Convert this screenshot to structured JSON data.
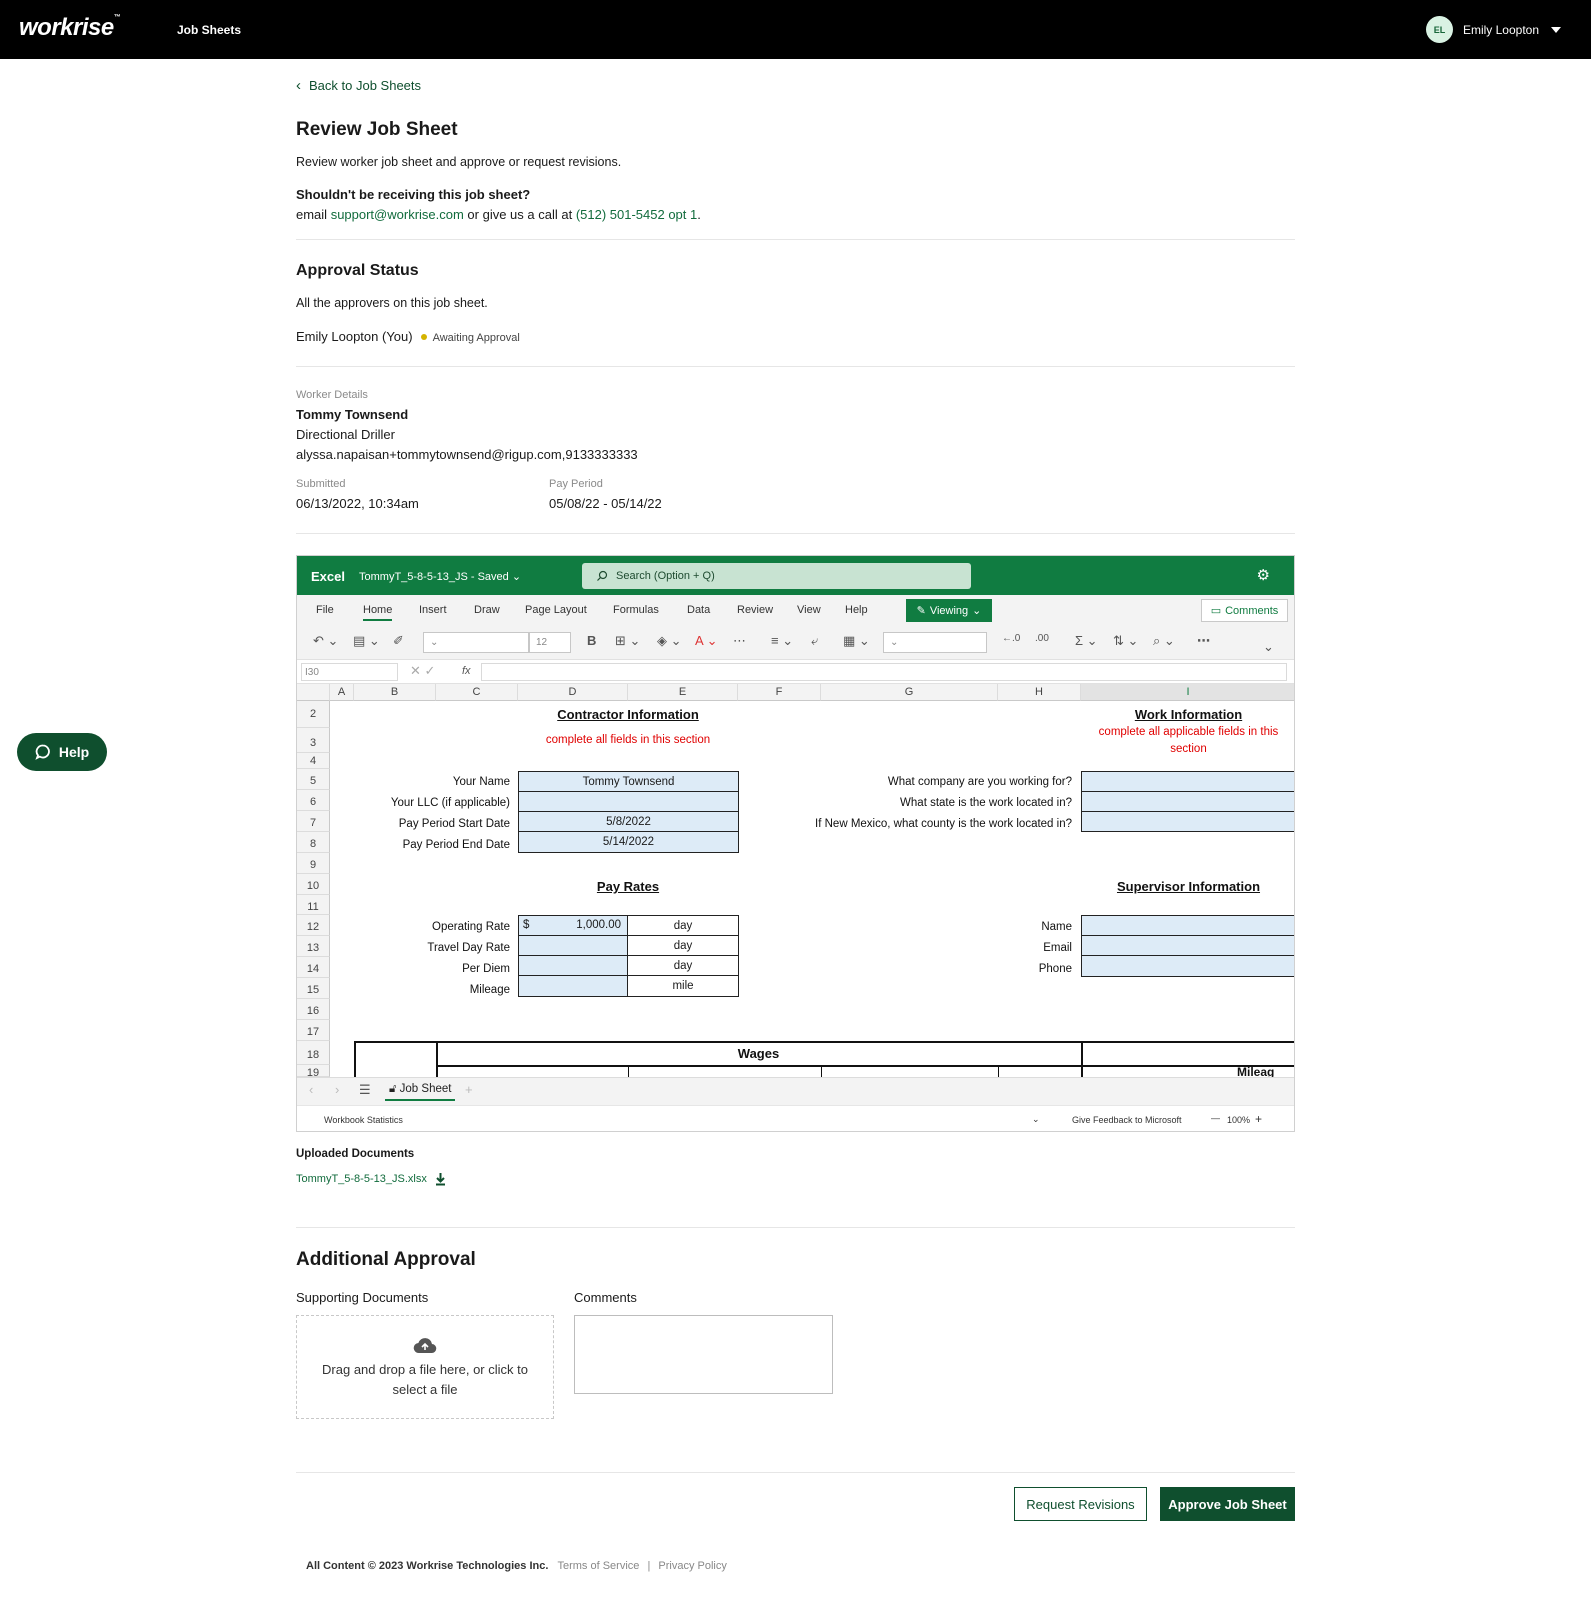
{
  "topbar": {
    "logo": "workrise",
    "logo_mark": "™",
    "nav_item": "Job Sheets",
    "user_initials": "EL",
    "user_name": "Emily Loopton"
  },
  "back_link": "Back to Job Sheets",
  "page": {
    "title": "Review Job Sheet",
    "subtitle": "Review worker job sheet and approve or request revisions.",
    "question": "Shouldn't be receiving this job sheet?",
    "contact_prefix": "email ",
    "contact_email": "support@workrise.com",
    "contact_mid": " or give us a call at ",
    "contact_phone": "(512) 501-5452 opt 1",
    "contact_suffix": "."
  },
  "approval_status": {
    "title": "Approval Status",
    "subtitle": "All the approvers on this job sheet.",
    "approver": "Emily Loopton (You)",
    "status": "Awaiting Approval",
    "status_color": "#d4b300"
  },
  "worker": {
    "section_label": "Worker Details",
    "name": "Tommy Townsend",
    "role": "Directional Driller",
    "contact": "alyssa.napaisan+tommytownsend@rigup.com,9133333333",
    "submitted_label": "Submitted",
    "submitted_value": "06/13/2022, 10:34am",
    "pay_period_label": "Pay Period",
    "pay_period_value": "05/08/22 - 05/14/22"
  },
  "excel": {
    "brand": "Excel",
    "file": "TommyT_5-8-5-13_JS  -  Saved ⌄",
    "search_placeholder": "Search (Option + Q)",
    "menu": [
      "File",
      "Home",
      "Insert",
      "Draw",
      "Page Layout",
      "Formulas",
      "Data",
      "Review",
      "View",
      "Help"
    ],
    "viewing": "Viewing",
    "comments": "Comments",
    "font_size": "12",
    "cell_ref": "I30",
    "fx": "fx",
    "columns": [
      "A",
      "B",
      "C",
      "D",
      "E",
      "F",
      "G",
      "H",
      "I"
    ],
    "rows": [
      "2",
      "3",
      "4",
      "5",
      "6",
      "7",
      "8",
      "9",
      "10",
      "11",
      "12",
      "13",
      "14",
      "15",
      "16",
      "17",
      "18",
      "19"
    ],
    "contractor_title": "Contractor Information",
    "contractor_note": "complete all fields in this section",
    "work_title": "Work Information",
    "work_note_1": "complete all applicable fields in this",
    "work_note_2": "section",
    "labels": {
      "your_name": "Your Name",
      "llc": "Your LLC (if applicable)",
      "start": "Pay Period Start Date",
      "end": "Pay Period End Date",
      "company": "What company are you working for?",
      "state": "What state is the work located in?",
      "county": "If New Mexico, what county is the work located in?",
      "pay_rates": "Pay Rates",
      "supervisor": "Supervisor Information",
      "operating": "Operating Rate",
      "travel": "Travel Day Rate",
      "per_diem": "Per Diem",
      "mileage": "Mileage",
      "sup_name": "Name",
      "sup_email": "Email",
      "sup_phone": "Phone",
      "wages": "Wages",
      "mileage_col": "Mileag"
    },
    "values": {
      "your_name": "Tommy Townsend",
      "start": "5/8/2022",
      "end": "5/14/2022",
      "currency": "$",
      "operating_rate": "1,000.00",
      "unit_day": "day",
      "unit_mile": "mile"
    },
    "sheet_tab": "Job Sheet",
    "status_left": "Workbook Statistics",
    "status_feedback": "Give Feedback to Microsoft",
    "zoom": "100%"
  },
  "uploaded": {
    "title": "Uploaded Documents",
    "file": "TommyT_5-8-5-13_JS.xlsx"
  },
  "additional": {
    "title": "Additional Approval",
    "supporting_label": "Supporting Documents",
    "drop_line1": "Drag and drop a file here, or click to",
    "drop_line2": "select a file",
    "comments_label": "Comments"
  },
  "buttons": {
    "request": "Request Revisions",
    "approve": "Approve Job Sheet"
  },
  "footer": {
    "copyright": "All Content © 2023 Workrise Technologies Inc.",
    "terms": "Terms of Service",
    "sep": "|",
    "privacy": "Privacy Policy"
  },
  "help": "Help",
  "colors": {
    "brand_green": "#0f4f2e",
    "excel_green": "#107c41",
    "cell_blue": "#ddebf7"
  }
}
